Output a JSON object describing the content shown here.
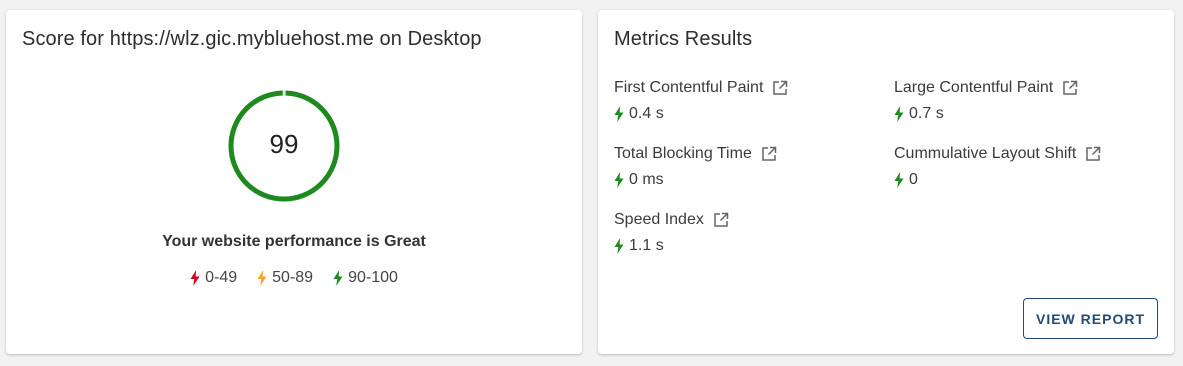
{
  "score_card": {
    "title": "Score for https://wlz.gic.mybluehost.me on Desktop",
    "score": "99",
    "score_fraction": 0.99,
    "ring_color": "#1e8a1e",
    "performance_text": "Your website performance is Great",
    "legend": [
      {
        "label": "0-49",
        "color": "#d0021b",
        "icon": "bolt-icon"
      },
      {
        "label": "50-89",
        "color": "#f5a623",
        "icon": "bolt-icon"
      },
      {
        "label": "90-100",
        "color": "#1e8a1e",
        "icon": "bolt-icon"
      }
    ]
  },
  "metrics_card": {
    "title": "Metrics Results",
    "metrics": [
      {
        "label": "First Contentful Paint",
        "value": "0.4 s",
        "status_color": "#1e8a1e",
        "icon": "external-link-icon"
      },
      {
        "label": "Large Contentful Paint",
        "value": "0.7 s",
        "status_color": "#1e8a1e",
        "icon": "external-link-icon"
      },
      {
        "label": "Total Blocking Time",
        "value": "0 ms",
        "status_color": "#1e8a1e",
        "icon": "external-link-icon"
      },
      {
        "label": "Cummulative Layout Shift",
        "value": "0",
        "status_color": "#1e8a1e",
        "icon": "external-link-icon"
      },
      {
        "label": "Speed Index",
        "value": "1.1 s",
        "status_color": "#1e8a1e",
        "icon": "external-link-icon"
      }
    ],
    "view_report_label": "VIEW REPORT",
    "button_color": "#1f4a7a"
  }
}
